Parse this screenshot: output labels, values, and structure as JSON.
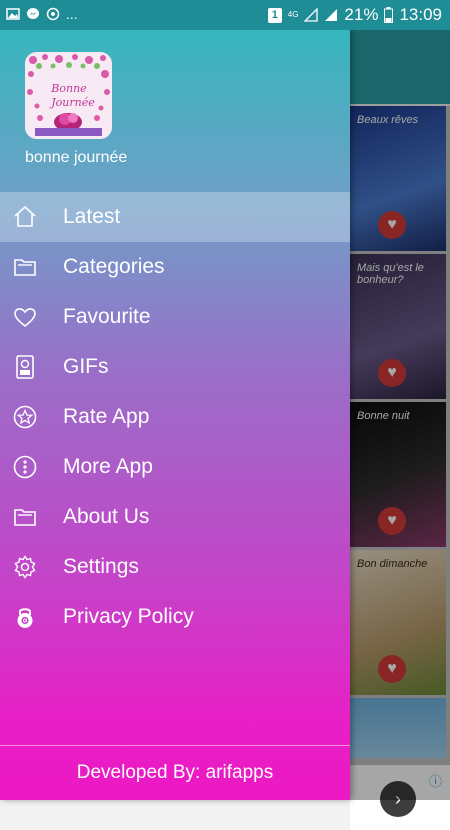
{
  "status_bar": {
    "notification_count": "1",
    "network_label": "4G",
    "battery": "21%",
    "time": "13:09",
    "more": "..."
  },
  "drawer": {
    "app_name": "bonne journée",
    "logo_text_line1": "Bonne",
    "logo_text_line2": "Journée",
    "menu": [
      {
        "label": "Latest",
        "icon": "home-icon",
        "active": true
      },
      {
        "label": "Categories",
        "icon": "folder-icon"
      },
      {
        "label": "Favourite",
        "icon": "heart-icon"
      },
      {
        "label": "GIFs",
        "icon": "gif-file-icon"
      },
      {
        "label": "Rate App",
        "icon": "star-circle-icon"
      },
      {
        "label": "More App",
        "icon": "more-circle-icon"
      },
      {
        "label": "About Us",
        "icon": "folder-icon"
      },
      {
        "label": "Settings",
        "icon": "gear-icon"
      },
      {
        "label": "Privacy Policy",
        "icon": "lock-icon"
      }
    ],
    "footer": "Developed By: arifapps"
  },
  "background": {
    "tiles": [
      {
        "text": "Beaux rêves",
        "color": "#2a4f9a"
      },
      {
        "text": "Mais qu'est le bonheur?",
        "color": "#4b3e6a"
      },
      {
        "text": "Bonne nuit",
        "color": "#111111"
      },
      {
        "text": "Bon dimanche",
        "color": "#d9c7a8"
      }
    ],
    "colors": {
      "toolbar": "#2a9ea6",
      "heart": "#d43a3a"
    }
  }
}
